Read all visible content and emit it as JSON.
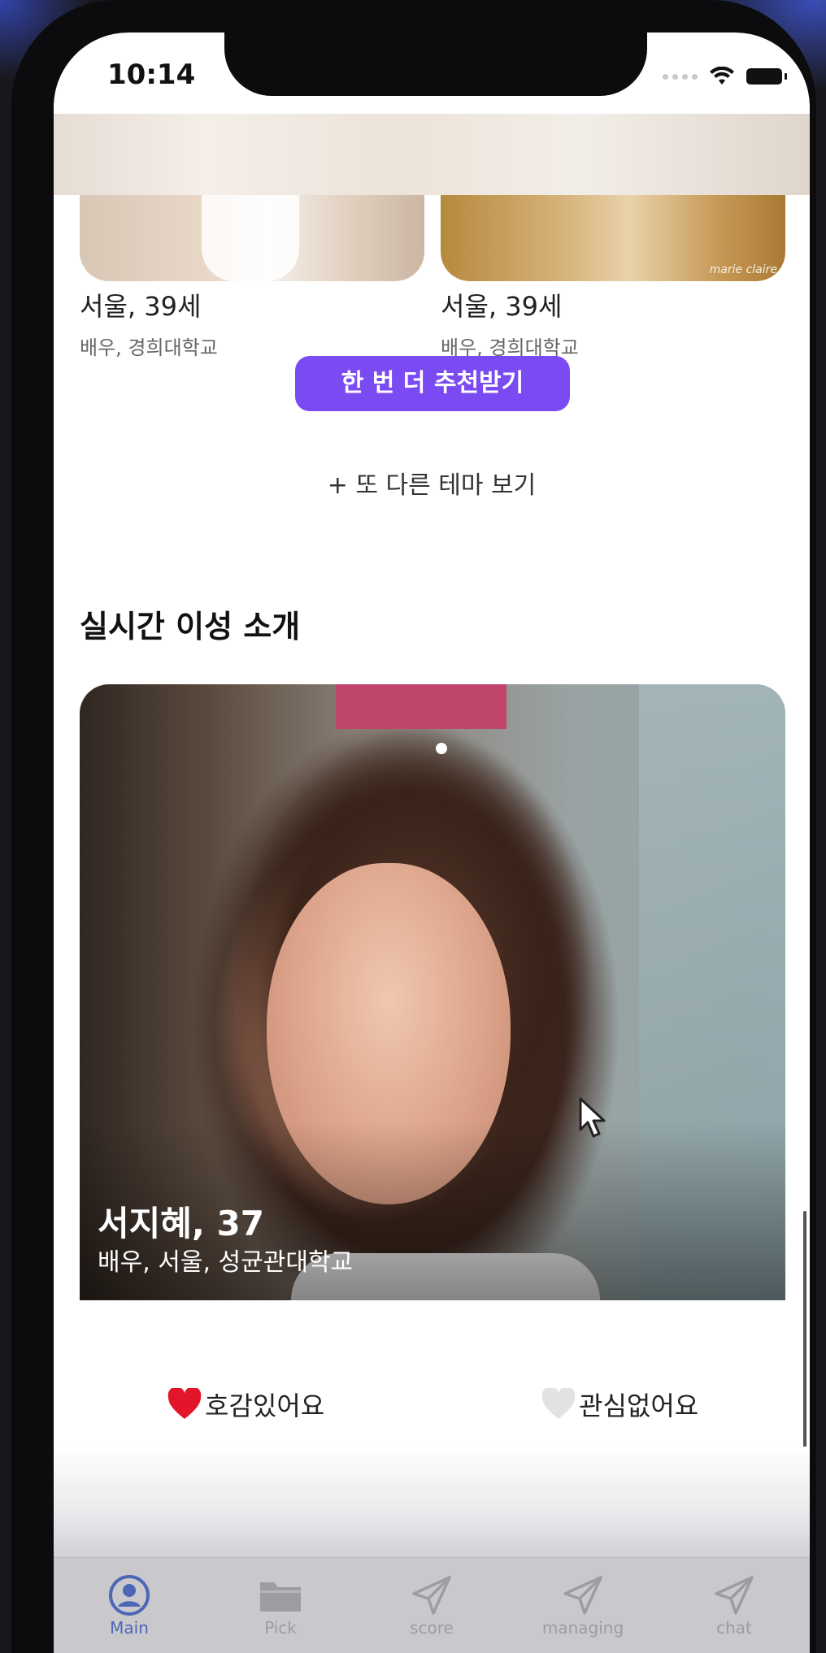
{
  "status": {
    "time": "10:14"
  },
  "cards": [
    {
      "location_age": "서울, 39세",
      "job_school": "배우, 경희대학교"
    },
    {
      "location_age": "서울, 39세",
      "job_school": "배우, 경희대학교",
      "watermark": "marie claire"
    }
  ],
  "recommend_button": "한 번 더 추천받기",
  "more_theme": "+ 또 다른 테마 보기",
  "section_title": "실시간 이성 소개",
  "profile": {
    "name_age": "서지혜, 37",
    "info": "배우, 서울, 성균관대학교"
  },
  "actions": {
    "like": "호감있어요",
    "pass": "관심없어요"
  },
  "tabs": [
    {
      "label": "Main",
      "icon": "person-circle-icon",
      "active": true
    },
    {
      "label": "Pick",
      "icon": "folder-icon"
    },
    {
      "label": "score",
      "icon": "send-icon"
    },
    {
      "label": "managing",
      "icon": "send-icon"
    },
    {
      "label": "chat",
      "icon": "send-icon"
    }
  ],
  "colors": {
    "accent": "#7a4af3",
    "tab_active": "#4d67b7",
    "tab_inactive": "#9c9ca3"
  }
}
